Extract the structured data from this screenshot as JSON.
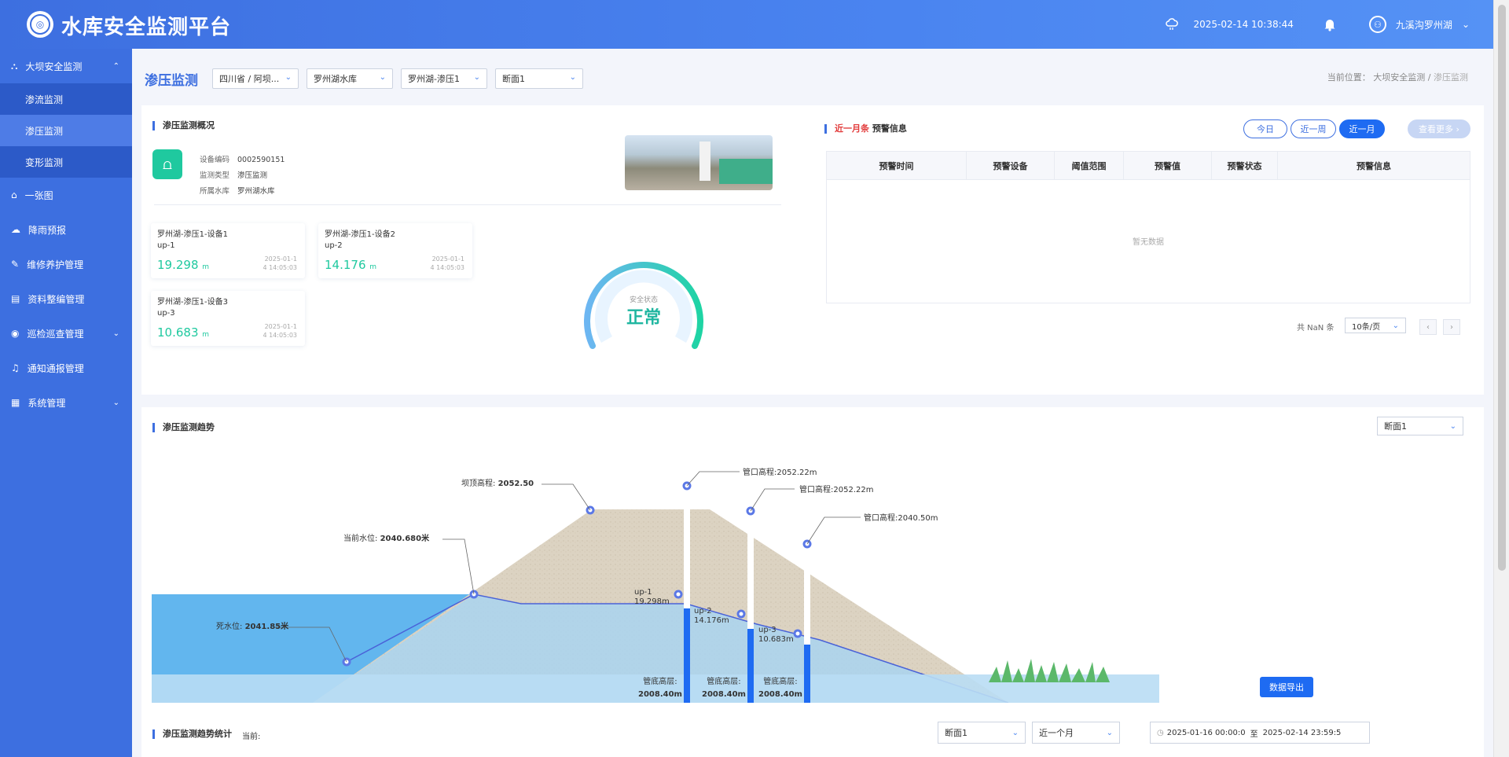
{
  "header": {
    "title": "水库安全监测平台",
    "datetime": "2025-02-14 10:38:44",
    "user": "九溪沟罗州湖"
  },
  "sidebar": {
    "items": [
      {
        "label": "大坝安全监测",
        "expanded": true
      },
      {
        "label": "渗流监测"
      },
      {
        "label": "渗压监测",
        "active": true
      },
      {
        "label": "变形监测"
      },
      {
        "label": "一张图"
      },
      {
        "label": "降雨预报"
      },
      {
        "label": "维修养护管理"
      },
      {
        "label": "资料整编管理"
      },
      {
        "label": "巡检巡查管理"
      },
      {
        "label": "通知通报管理"
      },
      {
        "label": "系统管理"
      }
    ]
  },
  "topbar": {
    "title": "渗压监测",
    "filters": [
      "四川省 / 阿坝...",
      "罗州湖水库",
      "罗州湖-渗压1",
      "断面1"
    ],
    "breadcrumb_label": "当前位置：",
    "breadcrumb": [
      "大坝安全监测",
      "渗压监测"
    ]
  },
  "overview": {
    "title": "渗压监测概况",
    "device_code_label": "设备编码",
    "device_code": "0002590151",
    "monitor_type_label": "监测类型",
    "monitor_type": "渗压监测",
    "reservoir_label": "所属水库",
    "reservoir": "罗州湖水库",
    "cards": [
      {
        "name": "罗州湖-渗压1-设备1",
        "code": "up-1",
        "value": "19.298",
        "unit": "m",
        "time1": "2025-01-1",
        "time2": "4 14:05:03"
      },
      {
        "name": "罗州湖-渗压1-设备2",
        "code": "up-2",
        "value": "14.176",
        "unit": "m",
        "time1": "2025-01-1",
        "time2": "4 14:05:03"
      },
      {
        "name": "罗州湖-渗压1-设备3",
        "code": "up-3",
        "value": "10.683",
        "unit": "m",
        "time1": "2025-01-1",
        "time2": "4 14:05:03"
      }
    ],
    "gauge_label": "安全状态",
    "gauge_status": "正常"
  },
  "warning": {
    "title_red": "近一月条",
    "title": "预警信息",
    "buttons": [
      "今日",
      "近一周",
      "近一月"
    ],
    "more": "查看更多 ›",
    "columns": [
      "预警时间",
      "预警设备",
      "阈值范围",
      "预警值",
      "预警状态",
      "预警信息"
    ],
    "empty": "暂无数据",
    "total": "共 NaN 条",
    "page_size": "10条/页"
  },
  "trend": {
    "title": "渗压监测趋势",
    "section": "断面1",
    "crest_label": "坝顶高程:",
    "crest_value": "2052.50",
    "water_label": "当前水位:",
    "water_value": "2040.680米",
    "dead_label": "死水位:",
    "dead_value": "2041.85米",
    "pipe_tops": [
      "管口高程:2052.22m",
      "管口高程:2052.22m",
      "管口高程:2040.50m"
    ],
    "probes": [
      {
        "code": "up-1",
        "value": "19.298m"
      },
      {
        "code": "up-2",
        "value": "14.176m"
      },
      {
        "code": "up-3",
        "value": "10.683m"
      }
    ],
    "bottom_label": "管底高层:",
    "bottom_value": "2008.40m"
  },
  "stats": {
    "title": "渗压监测趋势统计",
    "current": "当前:",
    "section": "断面1",
    "period": "近一个月",
    "start": "2025-01-16 00:00:0",
    "to": "至",
    "end": "2025-02-14 23:59:5",
    "export": "数据导出"
  }
}
